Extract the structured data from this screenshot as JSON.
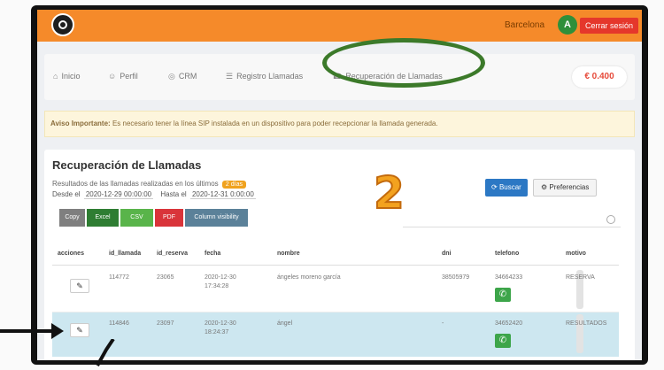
{
  "header": {
    "city": "Barcelona",
    "avatar_letter": "A",
    "logout_label": "Cerrar sesión",
    "logo_icon": "logo-icon"
  },
  "nav": {
    "items": [
      {
        "label": "Inicio",
        "icon": "home-icon"
      },
      {
        "label": "Perfil",
        "icon": "user-icon"
      },
      {
        "label": "CRM",
        "icon": "crm-icon"
      },
      {
        "label": "Registro Llamadas",
        "icon": "list-icon"
      },
      {
        "label": "Recuperación de Llamadas",
        "icon": "phone-icon"
      }
    ],
    "price": "€ 0.400"
  },
  "alert": {
    "bold": "Aviso Importante:",
    "text": " Es necesario tener la línea SIP instalada en un dispositivo para poder recepcionar la llamada generada."
  },
  "panel": {
    "title": "Recuperación de Llamadas",
    "subtitle": "Resultados de las llamadas realizadas en los últimos",
    "badge": "2 días",
    "from_label": "Desde el",
    "from_value": "2020-12-29 00:00:00",
    "to_label": "Hasta el",
    "to_value": "2020-12-31 0:00:00",
    "search_label": "Buscar",
    "prefs_label": "Preferencias",
    "annotation_digit": "2"
  },
  "exports": [
    "Copy",
    "Excel",
    "CSV",
    "PDF",
    "Column visibility"
  ],
  "table": {
    "headers": [
      "acciones",
      "id_llamada",
      "id_reserva",
      "fecha",
      "nombre",
      "dni",
      "telefono",
      "motivo"
    ],
    "rows": [
      {
        "id_llamada": "114772",
        "id_reserva": "23065",
        "fecha_date": "2020-12-30",
        "fecha_time": "17:34:28",
        "nombre": "ángeles moreno garcía",
        "dni": "38505979",
        "telefono": "34664233",
        "motivo": "RESERVA"
      },
      {
        "id_llamada": "114846",
        "id_reserva": "23097",
        "fecha_date": "2020-12-30",
        "fecha_time": "18:24:37",
        "nombre": "ángel",
        "dni": "-",
        "telefono": "34652420",
        "motivo": "RESULTADOS"
      }
    ]
  },
  "colors": {
    "topbar": "#f58a2a",
    "highlight_oval": "#3c7a2a",
    "selected_row": "#cde7f0"
  }
}
